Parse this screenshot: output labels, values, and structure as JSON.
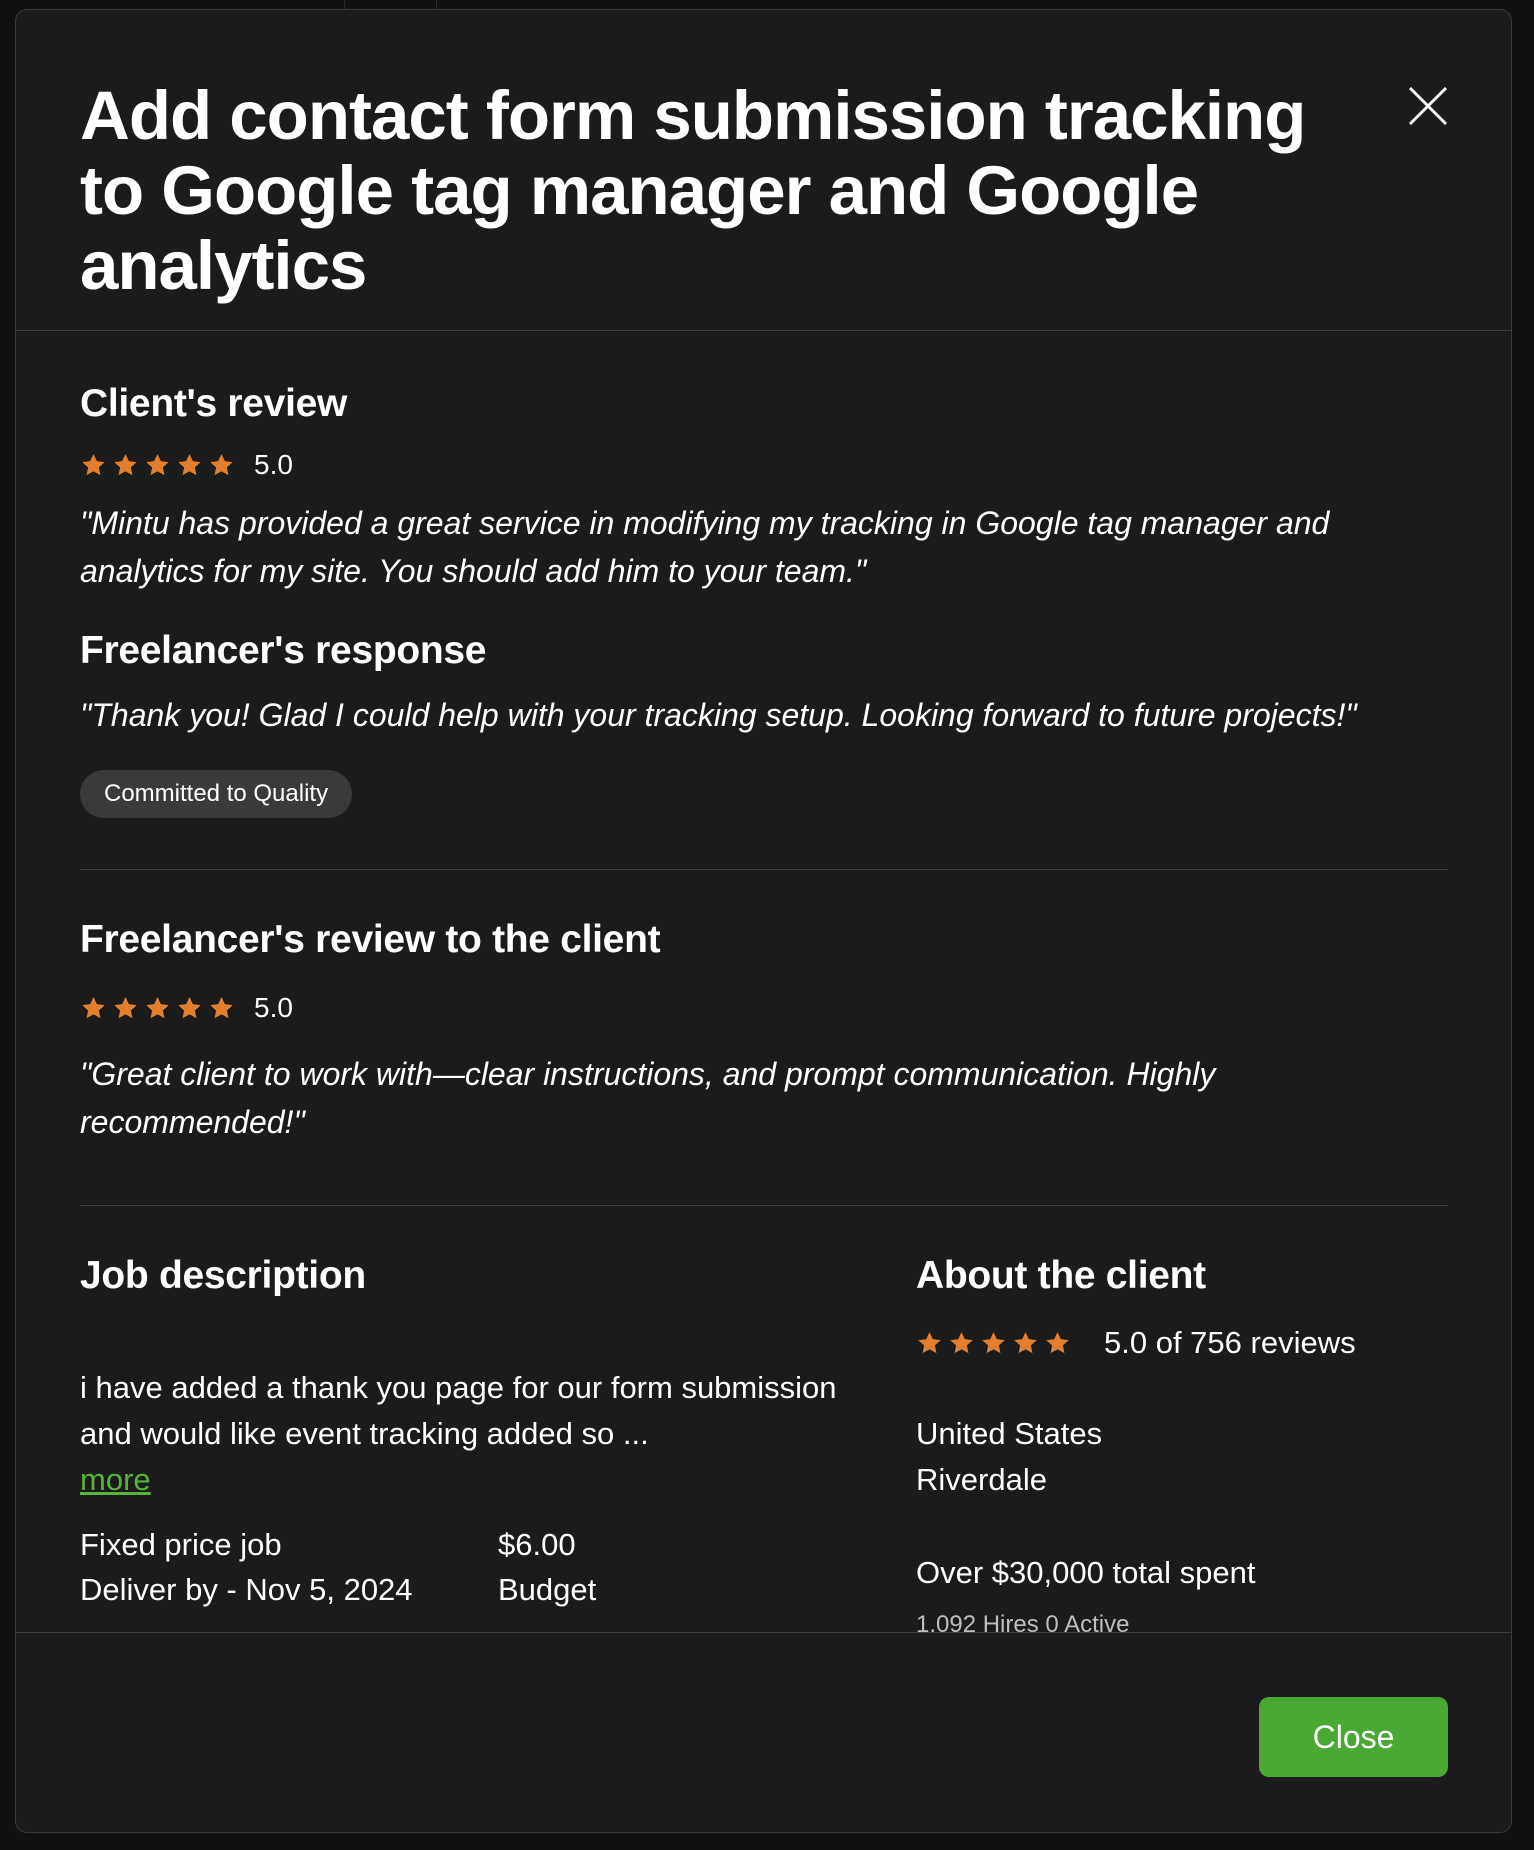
{
  "colors": {
    "modal_bg": "#1b1b1b",
    "star": "#e27f2e",
    "accent_green": "#4aa834",
    "link_green": "#58b33a",
    "badge_bg": "#3a3a3a"
  },
  "modal": {
    "title": "Add contact form submission tracking to Google tag manager and Google analytics",
    "close_icon": "close-icon"
  },
  "client_review": {
    "heading": "Client's review",
    "rating": "5.0",
    "stars": 5,
    "quote": "\"Mintu has provided a great service in modifying my tracking in Google tag manager and analytics for my site. You should add him to your team.\""
  },
  "freelancer_response": {
    "heading": "Freelancer's response",
    "quote": "\"Thank you! Glad I could help with your tracking setup. Looking forward to future projects!\"",
    "badge": "Committed to Quality"
  },
  "freelancer_review": {
    "heading": "Freelancer's review to the client",
    "rating": "5.0",
    "stars": 5,
    "quote": "\"Great client to work with—clear instructions, and prompt communication. Highly recommended!\""
  },
  "job": {
    "heading": "Job description",
    "description": "i have added a thank you page for our form submission and would like event tracking added so ...",
    "more_label": "more",
    "type": "Fixed price job",
    "deliver_by": "Deliver by - Nov 5, 2024",
    "price": "$6.00",
    "price_label": "Budget"
  },
  "client": {
    "heading": "About the client",
    "stars": 5,
    "rating_text": "5.0 of 756 reviews",
    "country": "United States",
    "city": "Riverdale",
    "total_spent": "Over $30,000 total spent",
    "hires": "1,092 Hires 0 Active"
  },
  "footer": {
    "close_label": "Close"
  }
}
